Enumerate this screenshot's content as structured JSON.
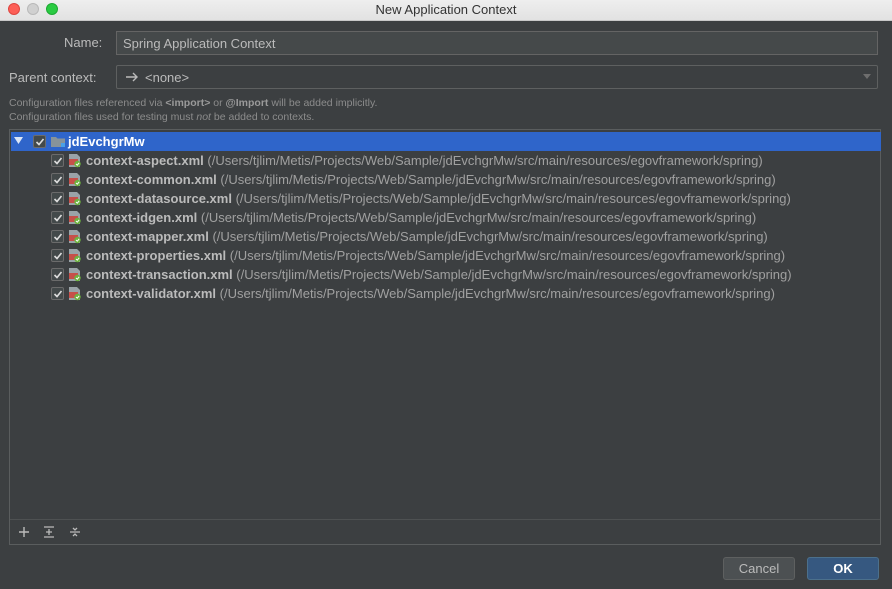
{
  "window": {
    "title": "New Application Context"
  },
  "form": {
    "name_label": "Name:",
    "name_value": "Spring Application Context",
    "parent_label": "Parent context:",
    "parent_value": "<none>",
    "hint_line1_pre": "Configuration files referenced via ",
    "hint_line1_import_tag": "<import>",
    "hint_line1_or": " or ",
    "hint_line1_import_ann": "@Import",
    "hint_line1_post": " will be added implicitly.",
    "hint_line2_pre": "Configuration files used for testing must ",
    "hint_line2_em": "not",
    "hint_line2_post": " be added to contexts."
  },
  "tree": {
    "root": {
      "label": "jdEvchgrMw",
      "checked": true,
      "expanded": true
    },
    "files": [
      {
        "name": "context-aspect.xml",
        "path": "(/Users/tjlim/Metis/Projects/Web/Sample/jdEvchgrMw/src/main/resources/egovframework/spring)",
        "checked": true
      },
      {
        "name": "context-common.xml",
        "path": "(/Users/tjlim/Metis/Projects/Web/Sample/jdEvchgrMw/src/main/resources/egovframework/spring)",
        "checked": true
      },
      {
        "name": "context-datasource.xml",
        "path": "(/Users/tjlim/Metis/Projects/Web/Sample/jdEvchgrMw/src/main/resources/egovframework/spring)",
        "checked": true
      },
      {
        "name": "context-idgen.xml",
        "path": "(/Users/tjlim/Metis/Projects/Web/Sample/jdEvchgrMw/src/main/resources/egovframework/spring)",
        "checked": true
      },
      {
        "name": "context-mapper.xml",
        "path": "(/Users/tjlim/Metis/Projects/Web/Sample/jdEvchgrMw/src/main/resources/egovframework/spring)",
        "checked": true
      },
      {
        "name": "context-properties.xml",
        "path": "(/Users/tjlim/Metis/Projects/Web/Sample/jdEvchgrMw/src/main/resources/egovframework/spring)",
        "checked": true
      },
      {
        "name": "context-transaction.xml",
        "path": "(/Users/tjlim/Metis/Projects/Web/Sample/jdEvchgrMw/src/main/resources/egovframework/spring)",
        "checked": true
      },
      {
        "name": "context-validator.xml",
        "path": "(/Users/tjlim/Metis/Projects/Web/Sample/jdEvchgrMw/src/main/resources/egovframework/spring)",
        "checked": true
      }
    ]
  },
  "toolbar": {
    "icons": [
      "plus-icon",
      "expand-all-icon",
      "collapse-all-icon"
    ]
  },
  "buttons": {
    "cancel_label": "Cancel",
    "ok_label": "OK"
  },
  "colors": {
    "background": "#3c3f41",
    "selection": "#2f65ca",
    "ok_button": "#365880",
    "xml_icon_red": "#c6504a",
    "spring_green": "#6db33f"
  }
}
